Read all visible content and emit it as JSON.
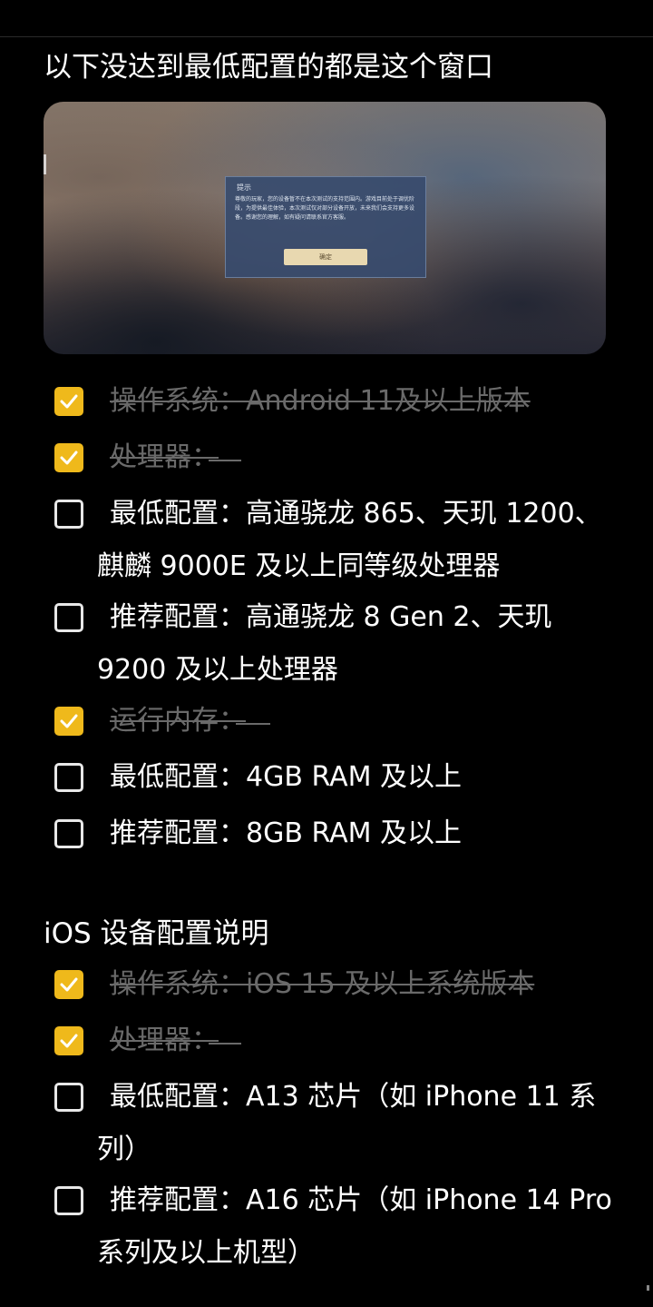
{
  "section1": {
    "heading": "以下没达到最低配置的都是这个窗口",
    "screenshot": {
      "dialog_title": "提示",
      "dialog_text": "尊敬的玩家，您的设备暂不在本次测试的支持范围内。游戏目前处于调优阶段，为提供最佳体验，本次测试仅对部分设备开放，未来我们会支持更多设备。感谢您的理解，如有疑问请联系官方客服。",
      "dialog_button": "确定"
    },
    "items": [
      {
        "checked": true,
        "text": "操作系统：Android 11及以上版本"
      },
      {
        "checked": true,
        "text": "处理器："
      },
      {
        "checked": false,
        "text": "最低配置：高通骁龙 865、天玑 1200、",
        "cont": "麒麟 9000E 及以上同等级处理器"
      },
      {
        "checked": false,
        "text": "推荐配置：高通骁龙 8 Gen 2、天玑",
        "cont": "9200 及以上处理器"
      },
      {
        "checked": true,
        "text": "运行内存："
      },
      {
        "checked": false,
        "text": "最低配置：4GB RAM 及以上"
      },
      {
        "checked": false,
        "text": "推荐配置：8GB RAM 及以上"
      }
    ]
  },
  "section2": {
    "heading": "iOS 设备配置说明",
    "items": [
      {
        "checked": true,
        "text": "操作系统：iOS 15 及以上系统版本"
      },
      {
        "checked": true,
        "text": "处理器："
      },
      {
        "checked": false,
        "text": "最低配置：A13 芯片（如 iPhone 11 系",
        "cont": "列）"
      },
      {
        "checked": false,
        "text": "推荐配置：A16 芯片（如 iPhone 14 Pro",
        "cont": "系列及以上机型）"
      }
    ]
  },
  "colors": {
    "checkbox_checked": "#efb91b",
    "struck_text": "#6a6a6a",
    "background": "#000000"
  },
  "icons": {
    "checked": "check-icon"
  }
}
